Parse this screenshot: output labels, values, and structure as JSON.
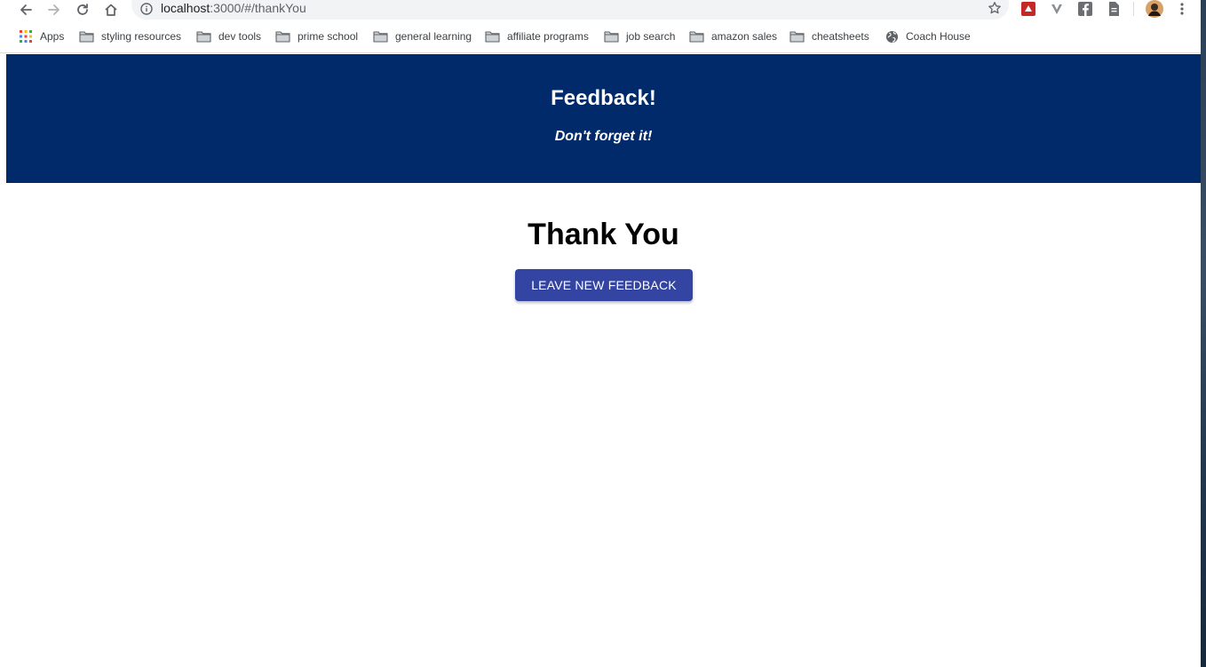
{
  "browser": {
    "url_host": "localhost",
    "url_path": ":3000/#/thankYou"
  },
  "bookmarks": [
    {
      "label": "Apps",
      "icon": "apps-grid-icon"
    },
    {
      "label": "styling resources",
      "icon": "folder-icon"
    },
    {
      "label": "dev tools",
      "icon": "folder-icon"
    },
    {
      "label": "prime school",
      "icon": "folder-icon"
    },
    {
      "label": "general learning",
      "icon": "folder-icon"
    },
    {
      "label": "affiliate programs",
      "icon": "folder-icon"
    },
    {
      "label": "job search",
      "icon": "folder-icon"
    },
    {
      "label": "amazon sales",
      "icon": "folder-icon"
    },
    {
      "label": "cheatsheets",
      "icon": "folder-icon"
    },
    {
      "label": "Coach House",
      "icon": "globe-icon"
    }
  ],
  "header": {
    "title": "Feedback!",
    "subtitle": "Don't forget it!"
  },
  "main": {
    "heading": "Thank You",
    "button_label": "LEAVE NEW FEEDBACK"
  },
  "colors": {
    "header_bg": "#002a6a",
    "button_bg": "#3344a3"
  }
}
